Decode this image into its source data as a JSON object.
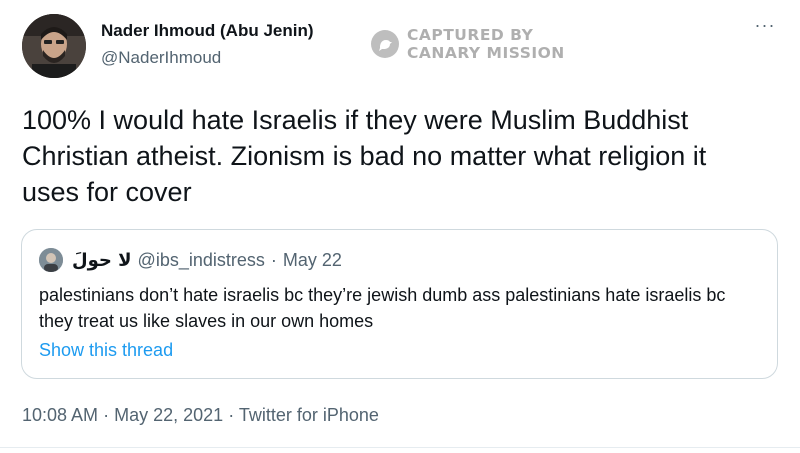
{
  "tweet": {
    "display_name": "Nader Ihmoud (Abu Jenin)",
    "handle": "@NaderIhmoud",
    "text": "100% I would hate Israelis if they were Muslim Buddhist Christian atheist. Zionism is bad no matter what religion it uses for cover",
    "more_label": "···",
    "timestamp": "10:08 AM",
    "date": "May 22, 2021",
    "source": "Twitter for iPhone",
    "separator": "·"
  },
  "watermark": {
    "line1": "CAPTURED BY",
    "line2": "CANARY MISSION"
  },
  "quote": {
    "display_name": "لا حولَ",
    "handle": "@ibs_indistress",
    "separator": "·",
    "date": "May 22",
    "text": "palestinians don’t hate israelis bc they’re jewish dumb ass palestinians hate israelis bc they treat us like slaves in our own homes",
    "show_thread": "Show this thread"
  },
  "colors": {
    "link": "#1d9bf0",
    "secondary_text": "#536471",
    "primary_text": "#0f1419",
    "border": "#cfd9de"
  }
}
